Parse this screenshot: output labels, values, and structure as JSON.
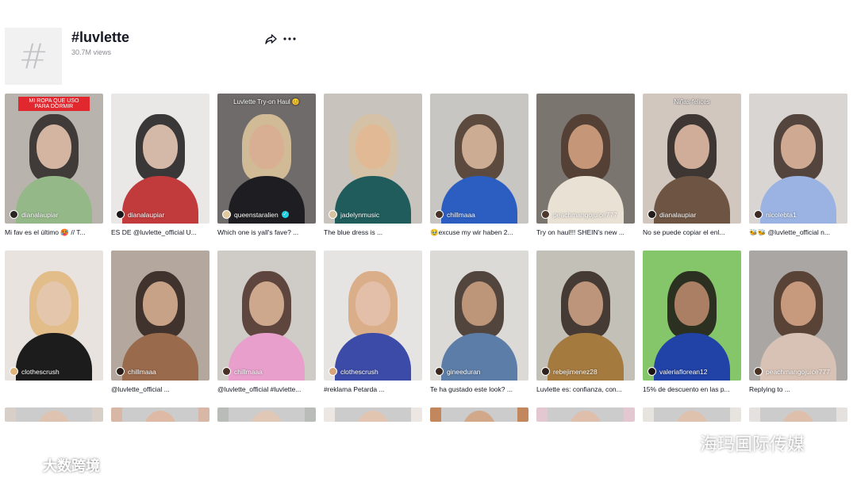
{
  "header": {
    "hashtag_symbol": "#",
    "title": "#luvlette",
    "views": "30.7M views",
    "share_icon": "share-icon",
    "more_icon": "more-icon"
  },
  "videos": [
    {
      "author": "dianalaupiar",
      "caption": "Mi fav es el último 🥵 // T...",
      "overlay": "MI ROPA QUE USO PARA DORMIR",
      "bg": "#b9b3ad",
      "skin": "#e3c3ad",
      "hair": "#2a2523",
      "cloth": "#95b889"
    },
    {
      "author": "dianalaupiar",
      "caption": "ES DE @luvlette_official U...",
      "overlay": "",
      "bg": "#e9e8e6",
      "skin": "#e5c8b5",
      "hair": "#1b1819",
      "cloth": "#c23b3c"
    },
    {
      "author": "queenstaralien",
      "verified": true,
      "caption": "Which one is yall's fave? ...",
      "overlay": "Luvlette Try-on Haul 😊",
      "bg": "#6f6b6a",
      "skin": "#d9ae92",
      "hair": "#e3c89e",
      "cloth": "#1e1e22"
    },
    {
      "author": "jadelynmusic",
      "caption": "The blue dress is ...",
      "overlay": "",
      "bg": "#c8c3bc",
      "skin": "#e2b994",
      "hair": "#d7c2a2",
      "cloth": "#1f5c5b"
    },
    {
      "author": "chillmaaa",
      "caption": "🥹excuse my wir haben 2...",
      "overlay": "",
      "bg": "#c7c6c2",
      "skin": "#d8b79b",
      "hair": "#4a3427",
      "cloth": "#2c5ec2"
    },
    {
      "author": "peachmangojuice777",
      "caption": "Try on haul!!! SHEIN's new ...",
      "overlay": "",
      "bg": "#7b7570",
      "skin": "#d2a07e",
      "hair": "#4d372a",
      "cloth": "#e9e1d4"
    },
    {
      "author": "dianalaupiar",
      "caption": "No se puede copiar el enl...",
      "overlay": "Niñas felices",
      "bg": "#d2c7bf",
      "skin": "#e0baa4",
      "hair": "#231c1a",
      "cloth": "#6e5543"
    },
    {
      "author": "nicolebta1",
      "caption": "🐝🐝 @luvlette_official n...",
      "overlay": "",
      "bg": "#d9d5d2",
      "skin": "#ddb49a",
      "hair": "#3b2b24",
      "cloth": "#9bb3e2"
    },
    {
      "author": "clothescrush",
      "caption": "",
      "overlay": "",
      "bg": "#e8e3df",
      "skin": "#e4c6b0",
      "hair": "#e0b57a",
      "cloth": "#1c1c1c"
    },
    {
      "author": "chillmaaa",
      "caption": "@luvlette_official ...",
      "overlay": "",
      "bg": "#b3a79e",
      "skin": "#d6ae91",
      "hair": "#2b1d18",
      "cloth": "#9a6a4c"
    },
    {
      "author": "chillmaaa",
      "caption": "@luvlette_official #luvlette...",
      "overlay": "",
      "bg": "#cfcbc6",
      "skin": "#d9b296",
      "hair": "#4a2f26",
      "cloth": "#e89fcc"
    },
    {
      "author": "clothescrush",
      "caption": "#reklama Petarda ...",
      "overlay": "",
      "bg": "#e6e4e2",
      "skin": "#e3c1ac",
      "hair": "#d8a47a",
      "cloth": "#3c4ba8"
    },
    {
      "author": "gineeduran",
      "caption": "Te ha gustado este look? ...",
      "overlay": "",
      "bg": "#dcdad7",
      "skin": "#c99d7f",
      "hair": "#3a2a22",
      "cloth": "#5c7da8"
    },
    {
      "author": "rebejimenez28",
      "caption": "Luvlette es: confianza, con...",
      "overlay": "",
      "bg": "#c3c0b8",
      "skin": "#caa083",
      "hair": "#2f221c",
      "cloth": "#a57a3f"
    },
    {
      "author": "valeriaflorean12",
      "caption": "15% de descuento en las p...",
      "overlay": "",
      "bg": "#86c66b",
      "skin": "#b9886b",
      "hair": "#1b1514",
      "cloth": "#2142a6"
    },
    {
      "author": "peachmangojuice777",
      "caption": "Replying to ...",
      "overlay": "",
      "bg": "#a9a6a3",
      "skin": "#d3a486",
      "hair": "#4b3124",
      "cloth": "#d8c2b5"
    },
    {
      "author": "",
      "caption": "",
      "overlay": "",
      "bg": "#d8cfc9",
      "skin": "#e0c2ad",
      "hair": "#3a2b25",
      "cloth": "#ccc"
    },
    {
      "author": "",
      "caption": "",
      "overlay": "",
      "bg": "#d9b7a6",
      "skin": "#e0b8a0",
      "hair": "#4a3228",
      "cloth": "#ccc"
    },
    {
      "author": "",
      "caption": "",
      "overlay": "",
      "bg": "#b9bcb8",
      "skin": "#e2c7b4",
      "hair": "#2d2421",
      "cloth": "#ccc"
    },
    {
      "author": "",
      "caption": "",
      "overlay": "",
      "bg": "#ece7e2",
      "skin": "#e3c4ae",
      "hair": "#3b2b24",
      "cloth": "#ccc"
    },
    {
      "author": "",
      "caption": "",
      "overlay": "",
      "bg": "#c2875d",
      "skin": "#d2a483",
      "hair": "#2a1d18",
      "cloth": "#ccc"
    },
    {
      "author": "",
      "caption": "",
      "overlay": "",
      "bg": "#e3c8d2",
      "skin": "#e1bca7",
      "hair": "#f27fb0",
      "cloth": "#ccc"
    },
    {
      "author": "",
      "caption": "",
      "overlay": "",
      "bg": "#e7e4e0",
      "skin": "#e0c1ab",
      "hair": "#3a2b26",
      "cloth": "#ccc"
    },
    {
      "author": "",
      "caption": "",
      "overlay": "",
      "bg": "#e4e1de",
      "skin": "#dfbea9",
      "hair": "#3c2c26",
      "cloth": "#ccc"
    }
  ],
  "watermarks": {
    "right": "海玛国际传媒",
    "left": "大数跨境"
  }
}
